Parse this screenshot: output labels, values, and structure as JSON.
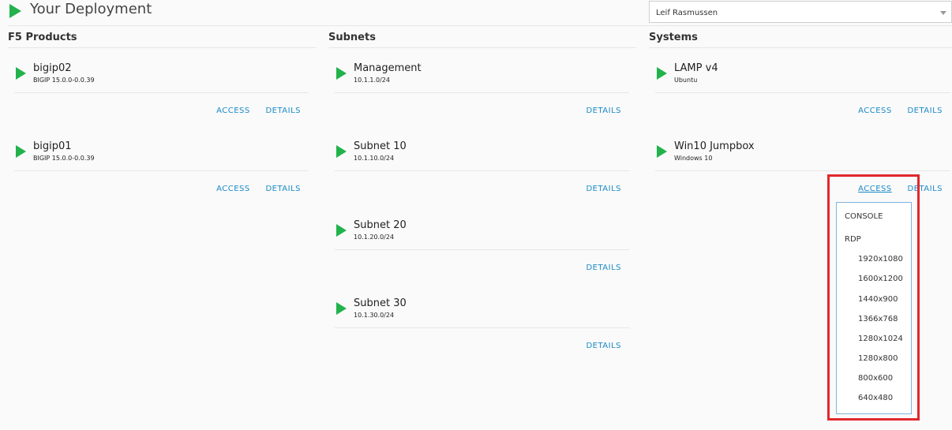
{
  "header": {
    "title": "Your Deployment",
    "user_select_value": "Leif Rasmussen"
  },
  "columns": {
    "products": {
      "title": "F5 Products",
      "items": [
        {
          "name": "bigip02",
          "sub": "BIGIP 15.0.0-0.0.39",
          "access": "ACCESS",
          "details": "DETAILS"
        },
        {
          "name": "bigip01",
          "sub": "BIGIP 15.0.0-0.0.39",
          "access": "ACCESS",
          "details": "DETAILS"
        }
      ]
    },
    "subnets": {
      "title": "Subnets",
      "items": [
        {
          "name": "Management",
          "sub": "10.1.1.0/24",
          "details": "DETAILS"
        },
        {
          "name": "Subnet 10",
          "sub": "10.1.10.0/24",
          "details": "DETAILS"
        },
        {
          "name": "Subnet 20",
          "sub": "10.1.20.0/24",
          "details": "DETAILS"
        },
        {
          "name": "Subnet 30",
          "sub": "10.1.30.0/24",
          "details": "DETAILS"
        }
      ]
    },
    "systems": {
      "title": "Systems",
      "items": [
        {
          "name": "LAMP v4",
          "sub": "Ubuntu",
          "access": "ACCESS",
          "details": "DETAILS"
        },
        {
          "name": "Win10 Jumpbox",
          "sub": "Windows 10",
          "access": "ACCESS",
          "details": "DETAILS"
        }
      ]
    }
  },
  "access_menu": {
    "console": "CONSOLE",
    "rdp": "RDP",
    "resolutions": [
      "1920x1080",
      "1600x1200",
      "1440x900",
      "1366x768",
      "1280x1024",
      "1280x800",
      "800x600",
      "640x480"
    ]
  },
  "colors": {
    "accent_green": "#22b24c",
    "link_blue": "#1a8ac6",
    "highlight_red": "#e0282d"
  },
  "icons": {
    "play": "play-triangle-icon",
    "dropdown_caret": "chevron-down-icon"
  }
}
